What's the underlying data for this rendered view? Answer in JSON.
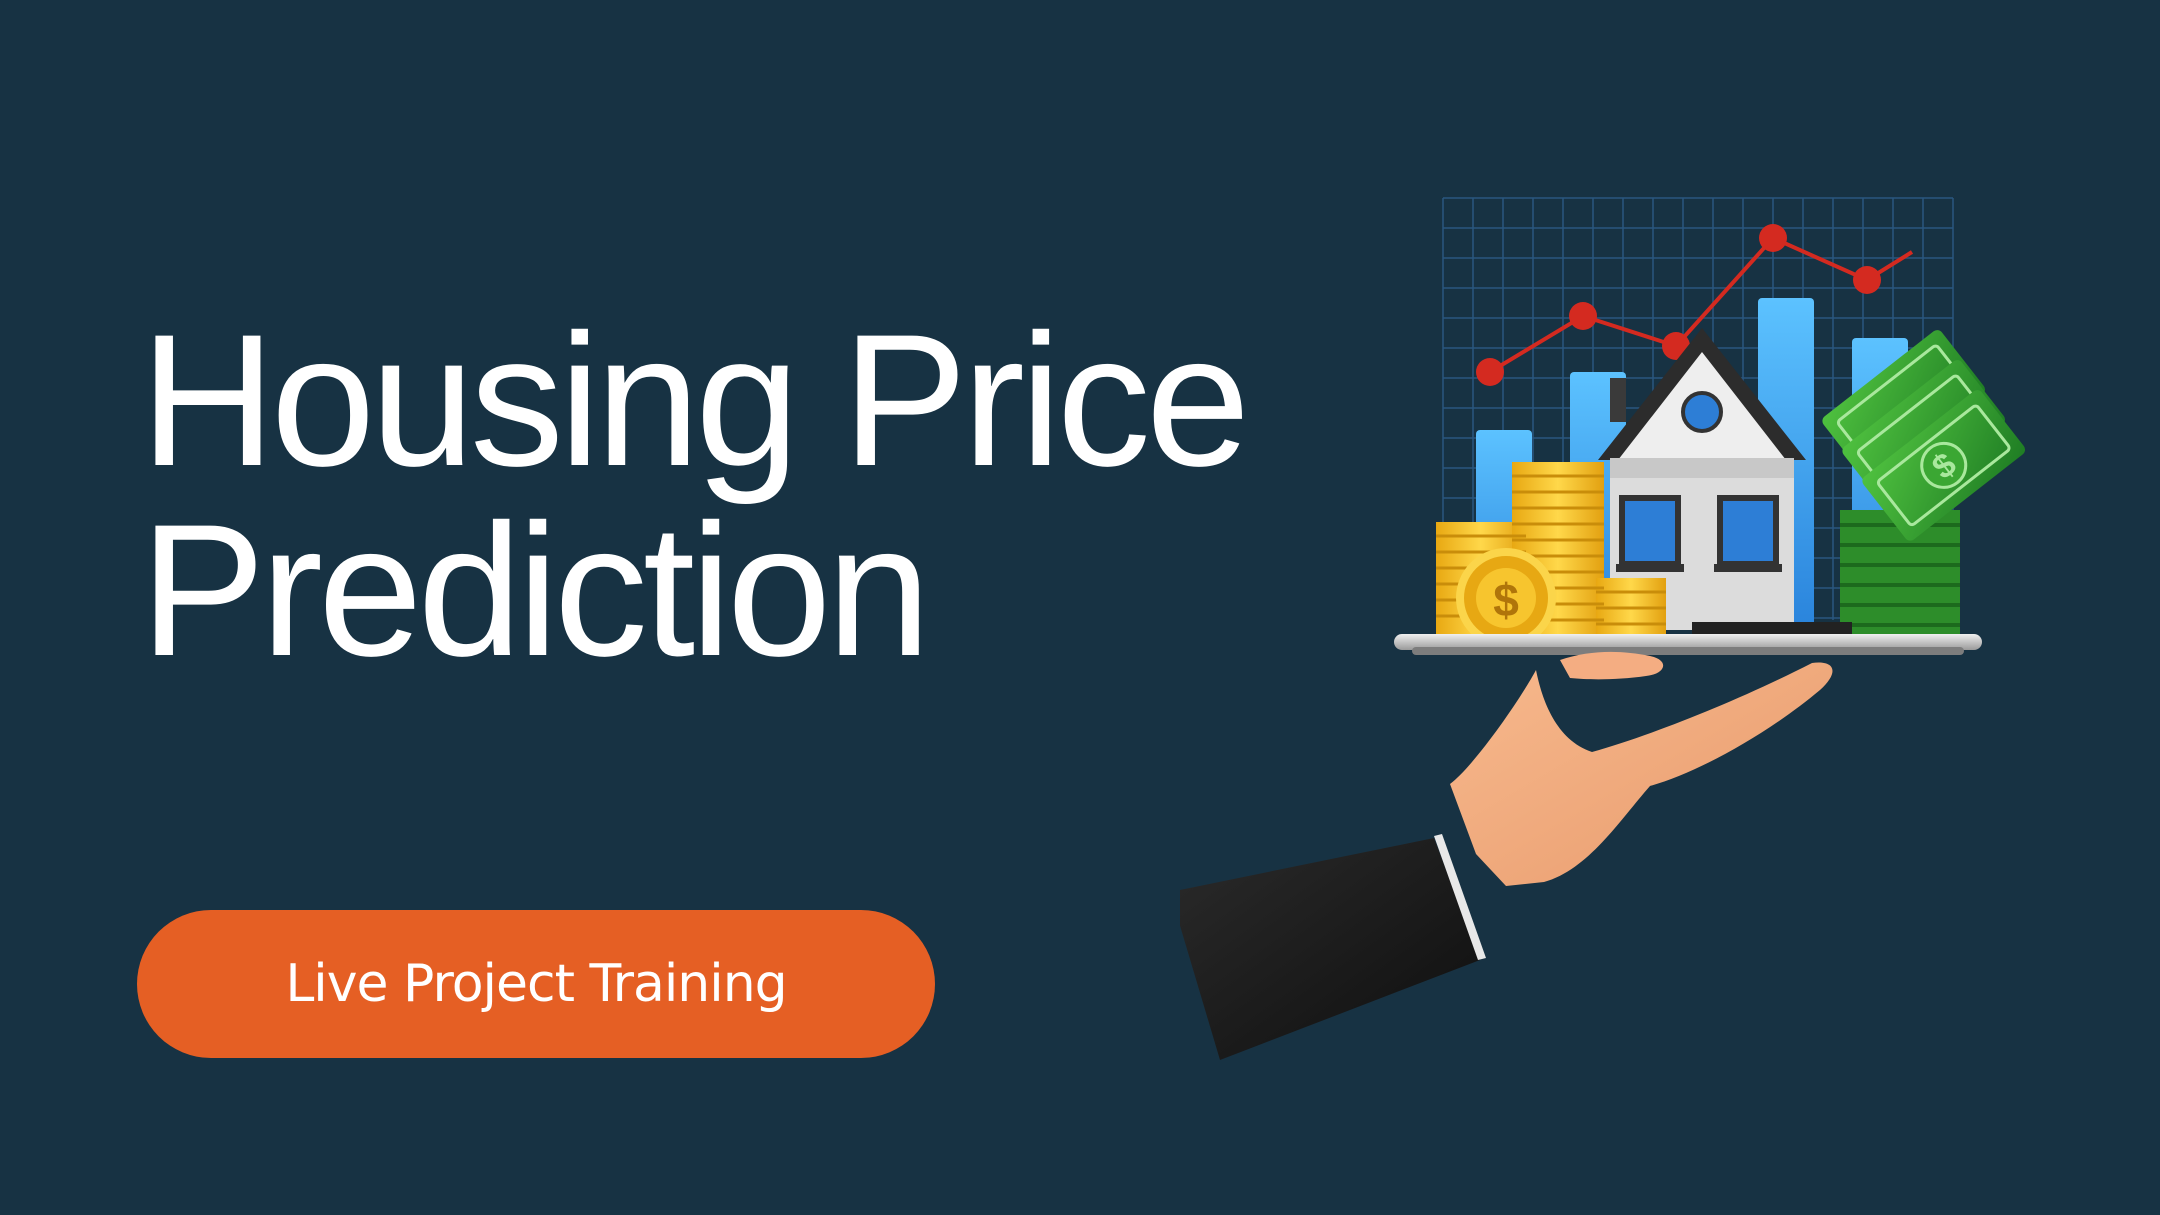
{
  "title": {
    "line1": "Housing Price",
    "line2": "Prediction"
  },
  "cta": {
    "label": "Live Project Training"
  },
  "illustration": {
    "icons": [
      "chart-grid-icon",
      "bar-chart-icon",
      "line-chart-icon",
      "house-icon",
      "coin-stack-icon",
      "dollar-coin-icon",
      "banknote-stack-icon",
      "hand-icon",
      "tray-icon"
    ]
  },
  "colors": {
    "background": "#173243",
    "accent": "#e55f24",
    "text": "#ffffff",
    "bar": "#4aa8f0",
    "trend": "#d42a20",
    "coin": "#f3c12a",
    "cash": "#2f9a2c"
  }
}
